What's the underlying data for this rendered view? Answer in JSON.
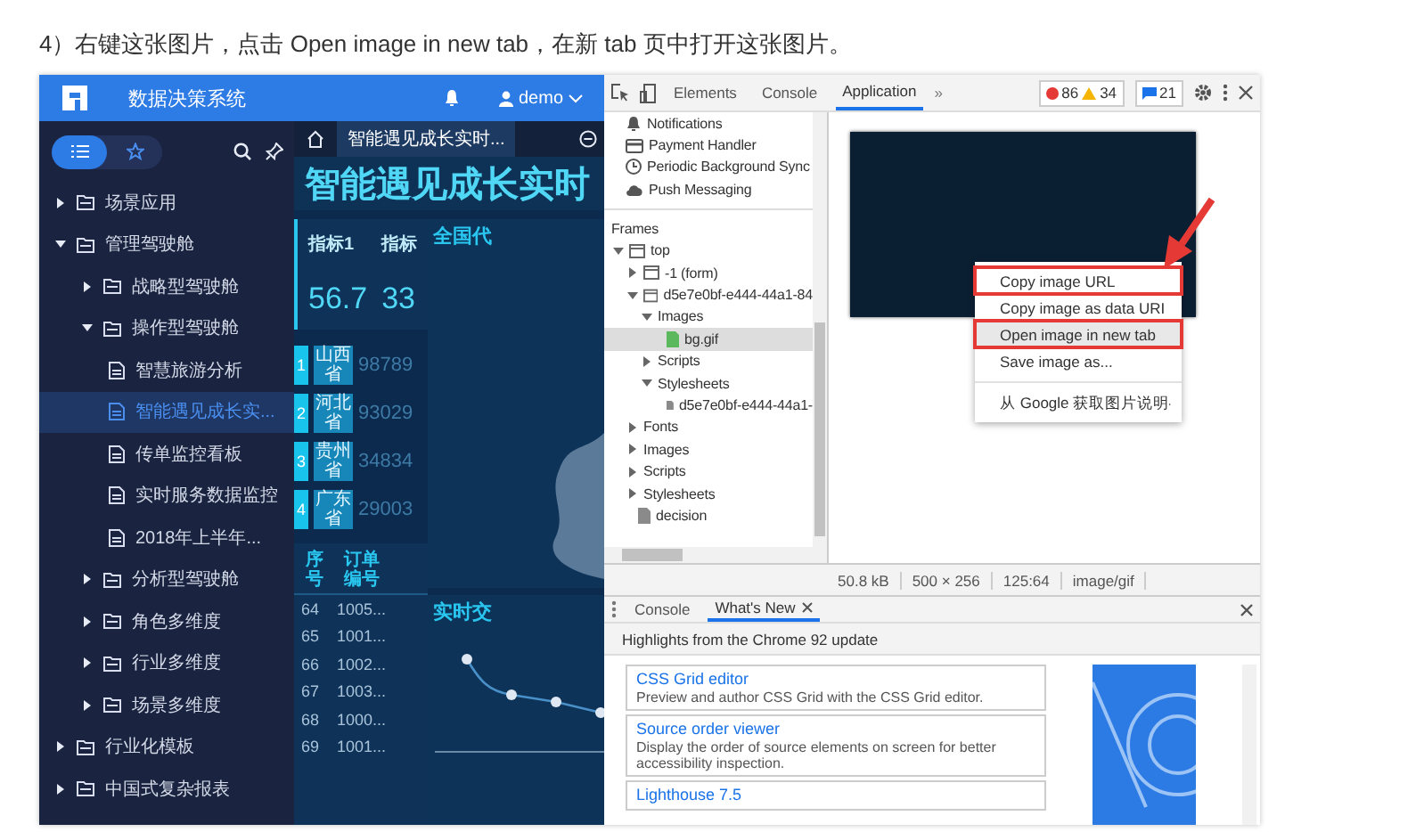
{
  "caption": "4）右键这张图片，点击 Open image in new tab，在新 tab 页中打开这张图片。",
  "app": {
    "title": "数据决策系统",
    "user": "demo",
    "sidebar_tabs": [
      {
        "kind": "list",
        "selected": true
      },
      {
        "kind": "favorite",
        "selected": false
      }
    ],
    "tree": [
      {
        "label": "场景应用",
        "kind": "folder",
        "expanded": false,
        "selected": false
      },
      {
        "label": "管理驾驶舱",
        "kind": "folder",
        "expanded": true,
        "selected": false,
        "children": [
          {
            "label": "战略型驾驶舱",
            "kind": "folder",
            "expanded": false,
            "selected": false
          },
          {
            "label": "操作型驾驶舱",
            "kind": "folder",
            "expanded": true,
            "selected": false,
            "children": [
              {
                "label": "智慧旅游分析",
                "kind": "report",
                "selected": false
              },
              {
                "label": "智能遇见成长实...",
                "kind": "report",
                "selected": true
              },
              {
                "label": "传单监控看板",
                "kind": "report",
                "selected": false
              },
              {
                "label": "实时服务数据监控",
                "kind": "report",
                "selected": false
              },
              {
                "label": "2018年上半年...",
                "kind": "report",
                "selected": false
              }
            ]
          },
          {
            "label": "分析型驾驶舱",
            "kind": "folder",
            "expanded": false,
            "selected": false
          },
          {
            "label": "角色多维度",
            "kind": "folder",
            "expanded": false,
            "selected": false
          },
          {
            "label": "行业多维度",
            "kind": "folder",
            "expanded": false,
            "selected": false
          },
          {
            "label": "场景多维度",
            "kind": "folder",
            "expanded": false,
            "selected": false
          }
        ]
      },
      {
        "label": "行业化模板",
        "kind": "folder",
        "expanded": false,
        "selected": false
      },
      {
        "label": "中国式复杂报表",
        "kind": "folder",
        "expanded": false,
        "selected": false
      }
    ],
    "content_tabs": [
      {
        "label": "智能遇见成长实时...",
        "selected": true
      }
    ],
    "dashboard": {
      "title": "智能遇见成长实时",
      "kpis": [
        {
          "label": "指标1",
          "value": "56.7"
        },
        {
          "label": "指标",
          "value": "33"
        }
      ],
      "ranking": [
        {
          "rank": "1",
          "name": "山西省",
          "value": "98789"
        },
        {
          "rank": "2",
          "name": "河北省",
          "value": "93029"
        },
        {
          "rank": "3",
          "name": "贵州省",
          "value": "34834"
        },
        {
          "rank": "4",
          "name": "广东省",
          "value": "29003"
        }
      ],
      "map_title": "全国代",
      "orders": {
        "columns": [
          "序号",
          "订单编号"
        ],
        "rows": [
          [
            "64",
            "1005..."
          ],
          [
            "65",
            "1001..."
          ],
          [
            "66",
            "1002..."
          ],
          [
            "67",
            "1003..."
          ],
          [
            "68",
            "1000..."
          ],
          [
            "69",
            "1001..."
          ]
        ]
      },
      "trend_title": "实时交"
    }
  },
  "devtools": {
    "tabs": [
      {
        "label": "Elements",
        "selected": false
      },
      {
        "label": "Console",
        "selected": false
      },
      {
        "label": "Application",
        "selected": true
      }
    ],
    "more": "»",
    "errors": "86",
    "warnings": "34",
    "messages": "21",
    "storage": [
      {
        "label": "Notifications",
        "kind": "bell"
      },
      {
        "label": "Payment Handler",
        "kind": "card"
      },
      {
        "label": "Periodic Background Sync",
        "kind": "clock"
      },
      {
        "label": "Push Messaging",
        "kind": "cloud"
      }
    ],
    "frames_heading": "Frames",
    "tree": [
      {
        "label": "top",
        "kind": "frame",
        "expanded": true,
        "selected": false,
        "children": [
          {
            "label": "-1 (form)",
            "kind": "frame",
            "expanded": false,
            "selected": false
          },
          {
            "label": "d5e7e0bf-e444-44a1-84",
            "kind": "frame",
            "expanded": true,
            "selected": false,
            "children": [
              {
                "label": "Images",
                "expanded": true,
                "selected": false,
                "children": [
                  {
                    "label": "bg.gif",
                    "kind": "image",
                    "selected": true
                  }
                ]
              },
              {
                "label": "Scripts",
                "expanded": false,
                "selected": false
              },
              {
                "label": "Stylesheets",
                "expanded": true,
                "selected": false,
                "children": [
                  {
                    "label": "d5e7e0bf-e444-44a1-",
                    "kind": "file",
                    "selected": false
                  }
                ]
              }
            ]
          },
          {
            "label": "Fonts",
            "expanded": false,
            "selected": false
          },
          {
            "label": "Images",
            "expanded": false,
            "selected": false
          },
          {
            "label": "Scripts",
            "expanded": false,
            "selected": false
          },
          {
            "label": "Stylesheets",
            "expanded": false,
            "selected": false
          },
          {
            "label": "decision",
            "kind": "file",
            "selected": false
          }
        ]
      }
    ],
    "menu": [
      [
        {
          "label": "Copy image URL",
          "selected": false,
          "annotated": true
        },
        {
          "label": "Copy image as data URI",
          "selected": false,
          "annotated": false
        },
        {
          "label": "Open image in new tab",
          "selected": true,
          "annotated": true
        },
        {
          "label": "Save image as...",
          "selected": false,
          "annotated": false
        }
      ],
      [
        {
          "label": "从 Google 获取图片说明",
          "selected": false,
          "annotated": false,
          "submenu": true
        }
      ]
    ],
    "status": [
      "50.8 kB",
      "500 × 256",
      "125:64",
      "image/gif"
    ],
    "drawer_tabs": [
      {
        "label": "Console",
        "selected": false,
        "closable": false
      },
      {
        "label": "What's New",
        "selected": true,
        "closable": true
      }
    ],
    "highlights": "Highlights from the Chrome 92 update",
    "cards": [
      {
        "title": "CSS Grid editor",
        "description": "Preview and author CSS Grid with the CSS Grid editor."
      },
      {
        "title": "Source order viewer",
        "description": "Display the order of source elements on screen for better accessibility inspection."
      },
      {
        "title": "Lighthouse 7.5"
      }
    ]
  }
}
